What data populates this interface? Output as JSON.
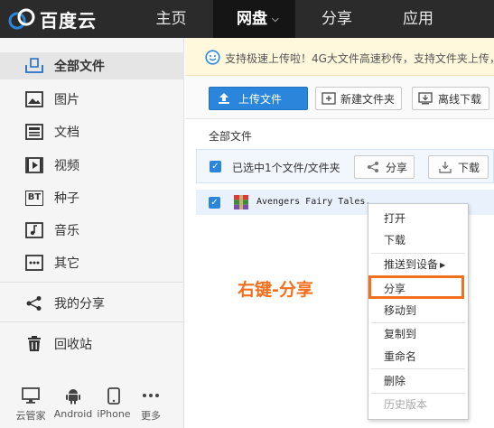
{
  "header": {
    "logo_text": "百度云",
    "nav": [
      {
        "label": "主页"
      },
      {
        "label": "网盘",
        "has_dropdown": true
      },
      {
        "label": "分享"
      },
      {
        "label": "应用"
      }
    ]
  },
  "sidebar": {
    "items": [
      {
        "label": "全部文件",
        "icon": "folder-icon",
        "active": true
      },
      {
        "label": "图片",
        "icon": "image-icon"
      },
      {
        "label": "文档",
        "icon": "document-icon"
      },
      {
        "label": "视频",
        "icon": "video-icon"
      },
      {
        "label": "种子",
        "icon": "bt-torrent-icon",
        "icon_text": "BT"
      },
      {
        "label": "音乐",
        "icon": "music-icon"
      },
      {
        "label": "其它",
        "icon": "other-icon"
      },
      {
        "label": "我的分享",
        "icon": "share-icon"
      },
      {
        "label": "回收站",
        "icon": "trash-icon"
      }
    ],
    "devices": [
      {
        "label": "云管家",
        "icon": "monitor-icon"
      },
      {
        "label": "Android",
        "icon": "android-icon"
      },
      {
        "label": "iPhone",
        "icon": "phone-icon"
      },
      {
        "label": "更多",
        "icon": "more-icon"
      }
    ]
  },
  "notice": {
    "text": "支持极速上传啦！4G大文件高速秒传，支持文件夹上传，"
  },
  "toolbar": {
    "upload_label": "上传文件",
    "new_folder_label": "新建文件夹",
    "offline_download_label": "离线下载"
  },
  "breadcrumb": "全部文件",
  "selection": {
    "text": "已选中1个文件/文件夹",
    "share_label": "分享",
    "download_label": "下载"
  },
  "file": {
    "name": "Avengers Fairy Tales.",
    "checked": true
  },
  "context_menu": {
    "items": [
      {
        "label": "打开"
      },
      {
        "label": "下载"
      },
      {
        "label": "推送到设备",
        "has_submenu": true,
        "arrow": "▶"
      },
      {
        "label": "分享",
        "highlighted": true
      },
      {
        "label": "移动到"
      },
      {
        "label": "复制到"
      },
      {
        "label": "重命名"
      },
      {
        "label": "删除"
      },
      {
        "label": "历史版本",
        "disabled": true
      }
    ]
  },
  "annotation": "右键-分享",
  "colors": {
    "accent_blue": "#2b86db",
    "highlight_orange": "#f26f1d",
    "topbar": "#2b2b2b"
  }
}
